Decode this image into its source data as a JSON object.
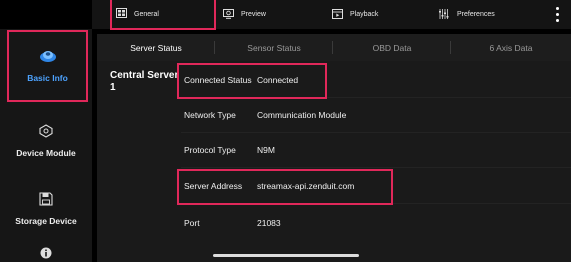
{
  "topbar": {
    "tabs": [
      {
        "label": "General",
        "icon": "general-icon"
      },
      {
        "label": "Preview",
        "icon": "preview-icon"
      },
      {
        "label": "Playback",
        "icon": "playback-icon"
      },
      {
        "label": "Preferences",
        "icon": "preferences-icon"
      }
    ],
    "active_tab": "General"
  },
  "sidebar": {
    "items": [
      {
        "label": "Basic Info",
        "icon": "basic-info-icon",
        "active": true
      },
      {
        "label": "Device Module",
        "icon": "device-module-icon"
      },
      {
        "label": "Storage Device",
        "icon": "storage-device-icon"
      },
      {
        "label": "",
        "icon": "info-icon"
      }
    ]
  },
  "subtabs": {
    "items": [
      "Server Status",
      "Sensor Status",
      "OBD Data",
      "6 Axis Data"
    ],
    "active": "Server Status"
  },
  "content": {
    "group_title": "Central Server 1",
    "rows": [
      {
        "key": "Connected Status",
        "value": "Connected"
      },
      {
        "key": "Network Type",
        "value": "Communication Module"
      },
      {
        "key": "Protocol Type",
        "value": "N9M"
      },
      {
        "key": "Server Address",
        "value": "streamax-api.zenduit.com"
      },
      {
        "key": "Port",
        "value": "21083"
      }
    ]
  },
  "colors": {
    "highlight": "#e0285a",
    "accent": "#4da3ff",
    "background": "#1a1a1a"
  }
}
